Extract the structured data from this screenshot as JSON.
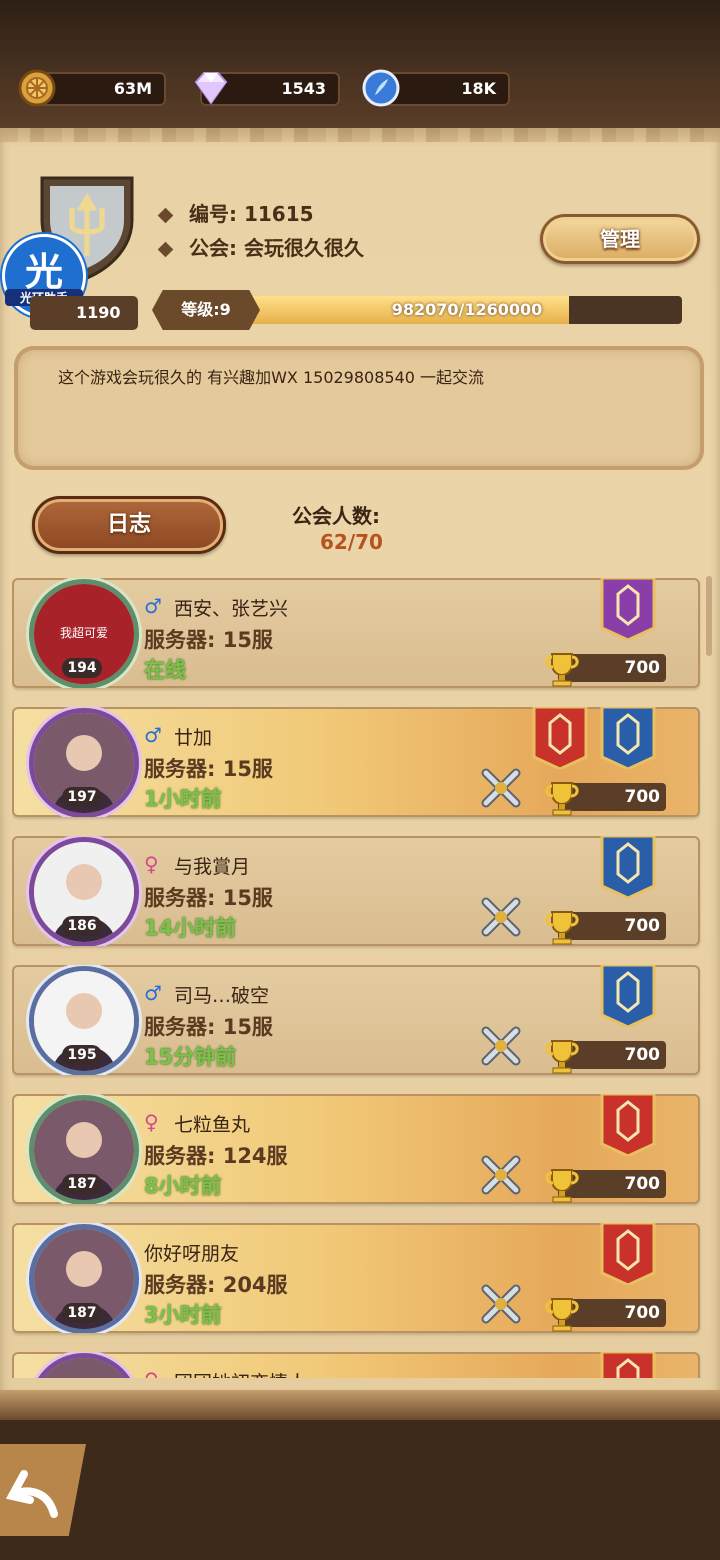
{
  "resources": [
    {
      "icon": "gold-coin-icon",
      "value": "63M"
    },
    {
      "icon": "diamond-icon",
      "value": "1543"
    },
    {
      "icon": "blue-crystal-icon",
      "value": "18K"
    }
  ],
  "guild": {
    "id_label": "编号: 11615",
    "name_label": "公会: 会玩很久很久",
    "manage_label": "管理",
    "trophies": "1190",
    "level_label": "等级:9",
    "exp": "982070/1260000",
    "exp_fraction": 0.779,
    "notice": "这个游戏会玩很久的 有兴趣加WX 15029808540 一起交流",
    "log_label": "日志",
    "member_count_label": "公会人数:",
    "member_count": "62/70"
  },
  "watermark": {
    "big": "光",
    "small": "光环助手"
  },
  "members": [
    {
      "gender": "m",
      "gender_icon": "male-icon",
      "name": "西安、张艺兴",
      "server": "服务器: 15服",
      "status": "在线",
      "level": "194",
      "trophies": "700",
      "avatar_text": "我超可爱",
      "style": "plain",
      "ring": "green",
      "swords": false,
      "banners": [
        "purple"
      ]
    },
    {
      "gender": "m",
      "gender_icon": "male-icon",
      "name": "廿加",
      "server": "服务器: 15服",
      "status": "1小时前",
      "level": "197",
      "trophies": "700",
      "avatar_text": "",
      "style": "gold",
      "ring": "purple",
      "swords": true,
      "banners": [
        "red",
        "blue"
      ]
    },
    {
      "gender": "f",
      "gender_icon": "female-icon",
      "name": "与我賞月",
      "server": "服务器: 15服",
      "status": "14小时前",
      "level": "186",
      "trophies": "700",
      "avatar_text": "",
      "style": "plain",
      "ring": "purple",
      "swords": true,
      "banners": [
        "blue"
      ]
    },
    {
      "gender": "m",
      "gender_icon": "male-icon",
      "name": "司马…破空",
      "server": "服务器: 15服",
      "status": "15分钟前",
      "level": "195",
      "trophies": "700",
      "avatar_text": "",
      "style": "plain",
      "ring": "blue",
      "swords": true,
      "banners": [
        "blue"
      ]
    },
    {
      "gender": "f",
      "gender_icon": "female-icon",
      "name": "七粒鱼丸",
      "server": "服务器: 124服",
      "status": "8小时前",
      "level": "187",
      "trophies": "700",
      "avatar_text": "",
      "style": "gold",
      "ring": "green",
      "swords": true,
      "banners": [
        "red"
      ]
    },
    {
      "gender": "",
      "gender_icon": "",
      "name": "你好呀朋友",
      "server": "服务器: 204服",
      "status": "3小时前",
      "level": "187",
      "trophies": "700",
      "avatar_text": "",
      "style": "gold",
      "ring": "blue",
      "swords": true,
      "banners": [
        "red"
      ]
    },
    {
      "gender": "f",
      "gender_icon": "female-icon",
      "name": "团团她初恋情人",
      "server": "",
      "status": "",
      "level": "",
      "trophies": "",
      "avatar_text": "",
      "style": "gold",
      "ring": "purple",
      "swords": false,
      "banners": [
        "red"
      ]
    }
  ],
  "colors": {
    "banner_purple": "#8a3fa8",
    "banner_red": "#c8322a",
    "banner_blue": "#2a5ea8",
    "online_green": "#7ac24a"
  }
}
